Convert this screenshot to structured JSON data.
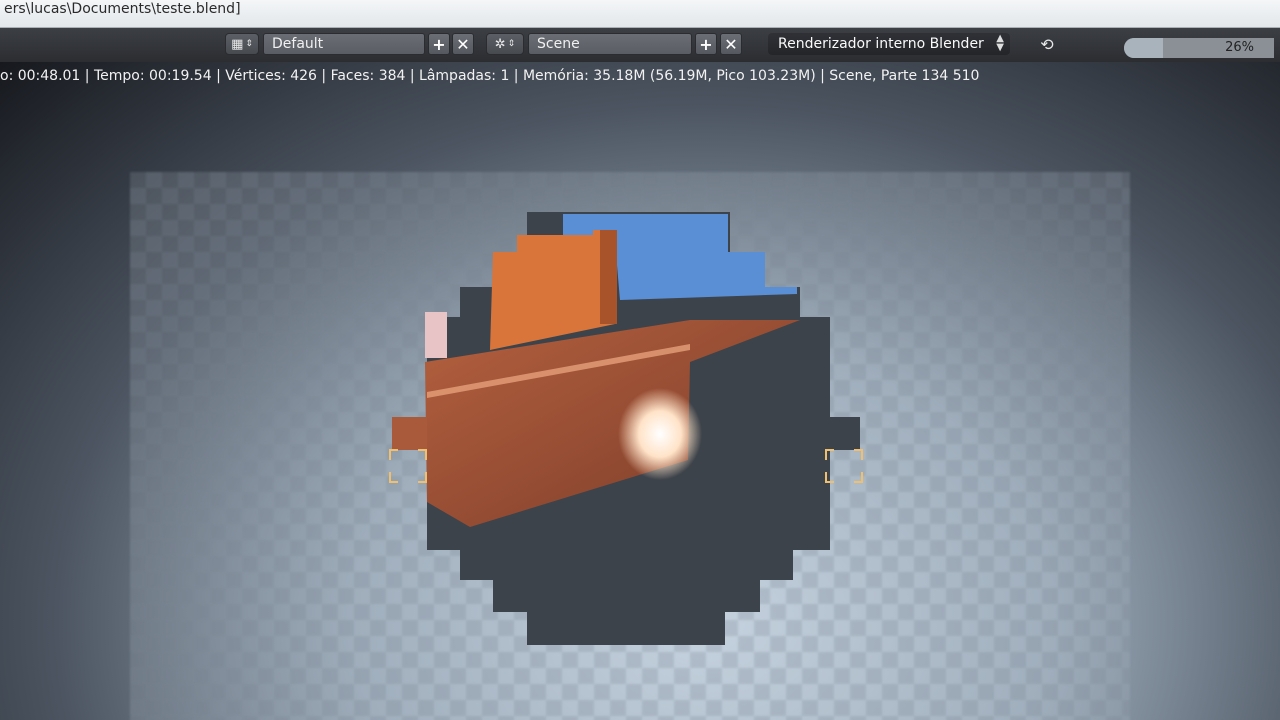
{
  "window": {
    "title": "ers\\lucas\\Documents\\teste.blend]"
  },
  "header": {
    "layout_field": "Default",
    "scene_field": "Scene",
    "render_engine": "Renderizador interno Blender",
    "progress_percent": 26,
    "progress_text": "26%"
  },
  "render": {
    "status_line": "o: 00:48.01 | Tempo: 00:19.54 | Vértices: 426 | Faces: 384 | Lâmpadas: 1 | Memória: 35.18M (56.19M, Pico 103.23M) | Scene, Parte 134 510"
  },
  "colors": {
    "sky": "#5a8fd6",
    "orange": "#d9753a",
    "dark": "#3b4147",
    "floor": "#a85a3a"
  }
}
